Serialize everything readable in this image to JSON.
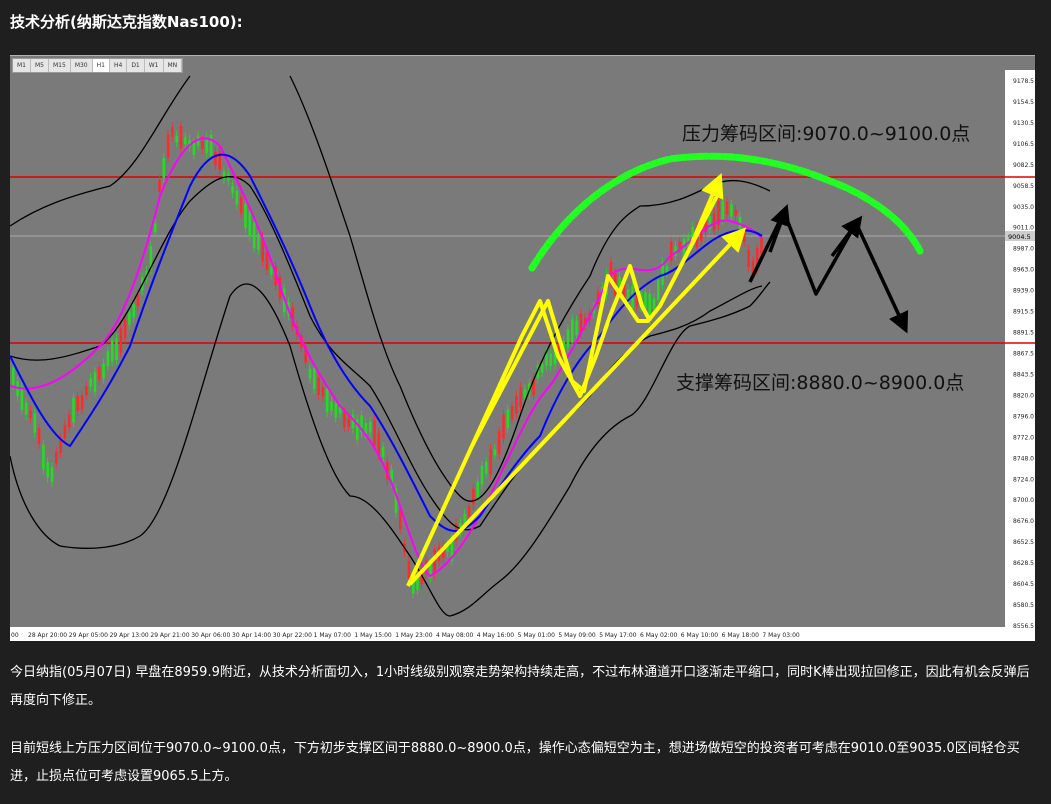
{
  "page": {
    "title": "技术分析(纳斯达克指数Nas100):"
  },
  "toolbar": {
    "timeframes": [
      "M1",
      "M5",
      "M15",
      "M30",
      "H1",
      "H4",
      "D1",
      "W1",
      "MN"
    ],
    "active_timeframe": "H1"
  },
  "chart": {
    "annotations": {
      "resistance": "压力筹码区间:9070.0~9100.0点",
      "support": "支撑筹码区间:8880.0~8900.0点"
    },
    "price_axis_labels": [
      "9178.5",
      "9154.5",
      "9130.5",
      "9106.5",
      "9082.5",
      "9058.5",
      "9035.0",
      "9011.0",
      "8987.0",
      "8963.0",
      "8939.0",
      "8915.5",
      "8891.5",
      "8867.5",
      "8843.5",
      "8820.0",
      "8796.0",
      "8772.0",
      "8748.0",
      "8724.0",
      "8700.0",
      "8676.0",
      "8652.5",
      "8628.5",
      "8604.5",
      "8580.5",
      "8556.5"
    ],
    "current_price_label": "9004.5",
    "time_axis_labels": [
      "00",
      "28 Apr 20:00",
      "29 Apr 05:00",
      "29 Apr 13:00",
      "29 Apr 21:00",
      "30 Apr 06:00",
      "30 Apr 14:00",
      "30 Apr 22:00",
      "1 May 07:00",
      "1 May 15:00",
      "1 May 23:00",
      "4 May 08:00",
      "4 May 16:00",
      "5 May 01:00",
      "5 May 09:00",
      "5 May 17:00",
      "6 May 02:00",
      "6 May 10:00",
      "6 May 18:00",
      "7 May 03:00"
    ],
    "colors": {
      "background": "#7a7a7a",
      "up_candle": "#ff2a2a",
      "down_candle": "#22dd22",
      "ma_fast": "#ff00ff",
      "ma_slow": "#0000ff",
      "bollinger": "#000000",
      "hline": "#e00000",
      "yellow_arrow": "#ffff00",
      "green_arc": "#22ff22",
      "black_arrow": "#000000"
    }
  },
  "article": {
    "paragraph1": "今日纳指(05月07日) 早盘在8959.9附近，从技术分析面切入，1小时线级别观察走势架构持续走高，不过布林通道开口逐渐走平缩口，同时K棒出现拉回修正，因此有机会反弹后再度向下修正。",
    "paragraph2": "目前短线上方压力区间位于9070.0~9100.0点，下方初步支撑区间于8880.0~8900.0点，操作心态偏短空为主，想进场做短空的投资者可考虑在9010.0至9035.0区间轻仓买进，止损点位可考虑设置9065.5上方。"
  }
}
